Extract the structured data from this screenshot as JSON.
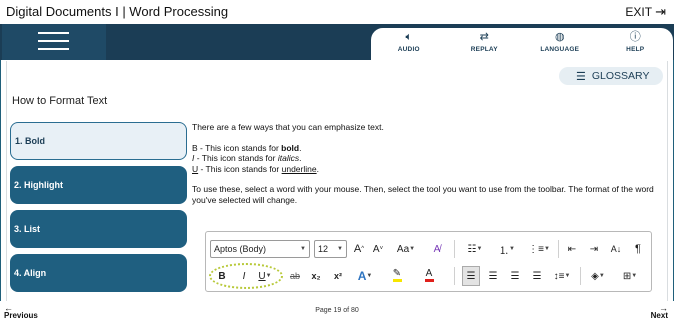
{
  "app": {
    "title": "Digital Documents I | Word Processing",
    "exit_label": "EXIT"
  },
  "header": {
    "tools": [
      {
        "label": "AUDIO",
        "icon": "speaker-icon"
      },
      {
        "label": "REPLAY",
        "icon": "replay-icon"
      },
      {
        "label": "LANGUAGE",
        "icon": "globe-icon"
      },
      {
        "label": "HELP",
        "icon": "help-icon"
      }
    ]
  },
  "glossary": {
    "label": "GLOSSARY"
  },
  "page": {
    "heading": "How to Format Text"
  },
  "sidebar": {
    "items": [
      {
        "label": "1. Bold",
        "active": true
      },
      {
        "label": "2. Highlight",
        "active": false
      },
      {
        "label": "3. List",
        "active": false
      },
      {
        "label": "4. Align",
        "active": false
      }
    ]
  },
  "content": {
    "intro": "There are a few ways that you can emphasize text.",
    "bold_line": {
      "key": "B",
      "text": " - This icon stands for ",
      "word": "bold",
      "end": "."
    },
    "italic_line": {
      "key": "I",
      "text": " - This icon stands for ",
      "word": "italics",
      "end": "."
    },
    "underline_line": {
      "key": "U",
      "text": " - This icon stands for ",
      "word": "underline",
      "end": "."
    },
    "instructions": "To use these, select a word with your mouse. Then, select the tool you want to use from the toolbar. The format of the word you've selected will change."
  },
  "toolbar": {
    "font_name": "Aptos (Body)",
    "font_size": "12",
    "bold": "B",
    "italic": "I",
    "underline": "U",
    "strike": "ab",
    "subscript": "x₂",
    "superscript": "x²",
    "grow_font": "A^",
    "shrink_font": "A˅",
    "change_case": "Aa",
    "highlight_color": "#f7e600",
    "font_color": "#e0201b"
  },
  "footer": {
    "prev_label": "Previous",
    "next_label": "Next",
    "page_indicator": "Page 19 of 80"
  },
  "colors": {
    "header_navy": "#1b3d55",
    "tab_blue": "#1f5f80",
    "active_tab_bg": "#e8f0f6",
    "glossary_bg": "#e6eef3"
  }
}
